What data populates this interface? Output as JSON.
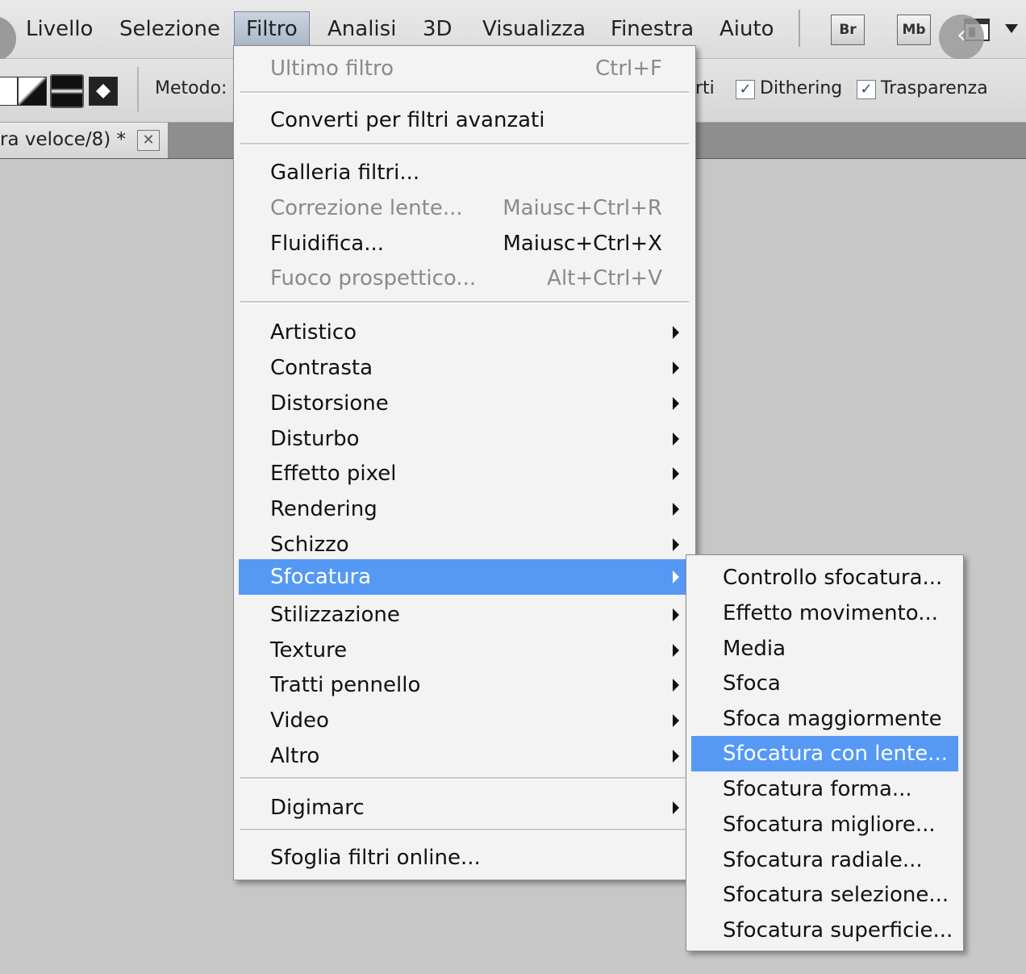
{
  "menubar": {
    "items": [
      "Livello",
      "Selezione",
      "Filtro",
      "Analisi",
      "3D",
      "Visualizza",
      "Finestra",
      "Aiuto"
    ],
    "active": "Filtro",
    "app_buttons": [
      "Br",
      "Mb"
    ]
  },
  "options": {
    "method_label": "Metodo:",
    "partial_text": "rti",
    "dithering_label": "Dithering",
    "dithering_checked": true,
    "trasparenza_label": "Trasparenza",
    "trasparenza_checked": true
  },
  "document_tab": {
    "title": "ra veloce/8) *"
  },
  "filtro_menu": {
    "last_filter": {
      "label": "Ultimo filtro",
      "shortcut": "Ctrl+F",
      "enabled": false
    },
    "convert": {
      "label": "Converti per filtri avanzati"
    },
    "galleria": {
      "label": "Galleria filtri..."
    },
    "correzione": {
      "label": "Correzione lente...",
      "shortcut": "Maiusc+Ctrl+R",
      "enabled": false
    },
    "fluidifica": {
      "label": "Fluidifica...",
      "shortcut": "Maiusc+Ctrl+X",
      "enabled": true
    },
    "fuoco": {
      "label": "Fuoco prospettico...",
      "shortcut": "Alt+Ctrl+V",
      "enabled": false
    },
    "categories": [
      "Artistico",
      "Contrasta",
      "Distorsione",
      "Disturbo",
      "Effetto pixel",
      "Rendering",
      "Schizzo",
      "Sfocatura",
      "Stilizzazione",
      "Texture",
      "Tratti pennello",
      "Video",
      "Altro"
    ],
    "highlighted_category": "Sfocatura",
    "digimarc": {
      "label": "Digimarc"
    },
    "online": {
      "label": "Sfoglia filtri online..."
    }
  },
  "sfocatura_submenu": {
    "items": [
      "Controllo sfocatura...",
      "Effetto movimento...",
      "Media",
      "Sfoca",
      "Sfoca maggiormente",
      "Sfocatura con lente...",
      "Sfocatura forma...",
      "Sfocatura migliore...",
      "Sfocatura radiale...",
      "Sfocatura selezione...",
      "Sfocatura superficie..."
    ],
    "highlighted": "Sfocatura con lente..."
  },
  "colors": {
    "highlight": "#5599f5",
    "canvas": "#c7c7c7"
  }
}
